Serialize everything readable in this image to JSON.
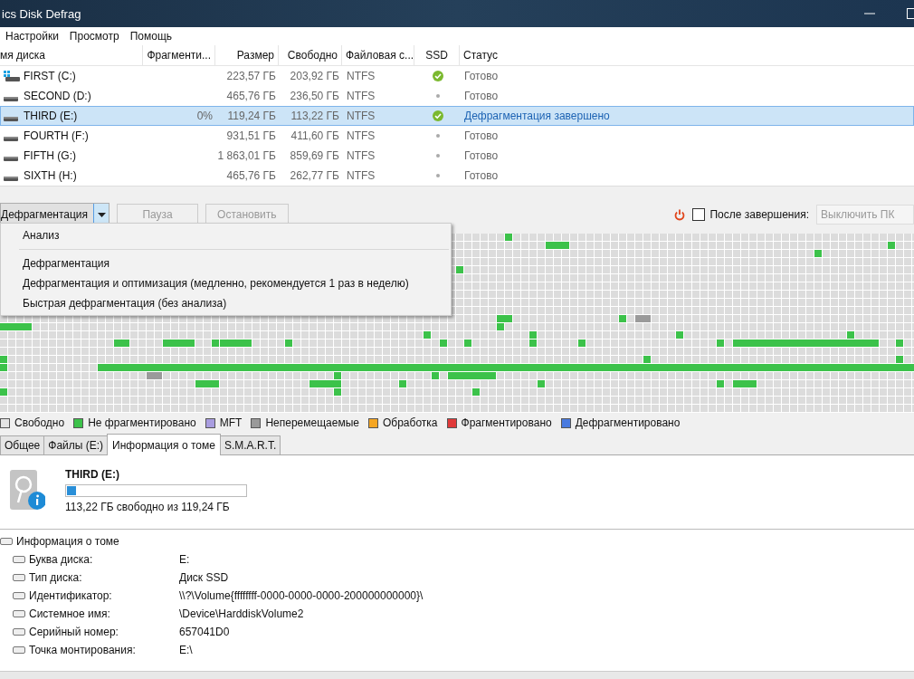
{
  "window": {
    "title": "ics Disk Defrag"
  },
  "menu": [
    "Настройки",
    "Просмотр",
    "Помощь"
  ],
  "disks": {
    "columns": [
      "мя диска",
      "Фрагменти...",
      "Размер",
      "Свободно",
      "Файловая с...",
      "SSD",
      "Статус"
    ],
    "rows": [
      {
        "kind": "system",
        "name": "FIRST (C:)",
        "fragmentation": "",
        "size": "223,57 ГБ",
        "free": "203,92 ГБ",
        "fs": "NTFS",
        "ssd": true,
        "status": "Готово",
        "selected": false
      },
      {
        "kind": "drive",
        "name": "SECOND (D:)",
        "fragmentation": "",
        "size": "465,76 ГБ",
        "free": "236,50 ГБ",
        "fs": "NTFS",
        "ssd": false,
        "status": "Готово",
        "selected": false
      },
      {
        "kind": "drive",
        "name": "THIRD (E:)",
        "fragmentation": "0%",
        "size": "119,24 ГБ",
        "free": "113,22 ГБ",
        "fs": "NTFS",
        "ssd": true,
        "status": "Дефрагментация завершено",
        "selected": true
      },
      {
        "kind": "drive",
        "name": "FOURTH (F:)",
        "fragmentation": "",
        "size": "931,51 ГБ",
        "free": "411,60 ГБ",
        "fs": "NTFS",
        "ssd": false,
        "status": "Готово",
        "selected": false
      },
      {
        "kind": "drive",
        "name": "FIFTH (G:)",
        "fragmentation": "",
        "size": "1 863,01 ГБ",
        "free": "859,69 ГБ",
        "fs": "NTFS",
        "ssd": false,
        "status": "Готово",
        "selected": false
      },
      {
        "kind": "drive",
        "name": "SIXTH (H:)",
        "fragmentation": "",
        "size": "465,76 ГБ",
        "free": "262,77 ГБ",
        "fs": "NTFS",
        "ssd": false,
        "status": "Готово",
        "selected": false
      }
    ]
  },
  "toolbar": {
    "action": "Дефрагментация",
    "pause": {
      "label": "Пауза",
      "disabled": true
    },
    "stop": {
      "label": "Остановить",
      "disabled": true
    },
    "after": {
      "checked": false,
      "disabled": true,
      "label": "После завершения:",
      "value": "Выключить ПК"
    }
  },
  "dropdown": [
    {
      "kind": "item",
      "label": "Анализ"
    },
    {
      "kind": "separator"
    },
    {
      "kind": "item",
      "label": "Дефрагментация"
    },
    {
      "kind": "item",
      "label": "Дефрагментация и оптимизация (медленно, рекомендуется 1 раз в неделю)"
    },
    {
      "kind": "item",
      "label": "Быстрая дефрагментация (без анализа)"
    }
  ],
  "legend": [
    {
      "label": "Свободно",
      "color": "#e4e4e4"
    },
    {
      "label": "Не фрагментировано",
      "color": "#3cc24a"
    },
    {
      "label": "MFT",
      "color": "#a99de0"
    },
    {
      "label": "Неперемещаемые",
      "color": "#9a9a9a"
    },
    {
      "label": "Обработка",
      "color": "#f5a623"
    },
    {
      "label": "Фрагментировано",
      "color": "#e03a3a"
    },
    {
      "label": "Дефрагментировано",
      "color": "#4a7be0"
    }
  ],
  "tabs": [
    {
      "label": "Общее",
      "selected": false
    },
    {
      "label": "Файлы (E:)",
      "selected": false
    },
    {
      "label": "Информация о томе",
      "selected": true
    },
    {
      "label": "S.M.A.R.T.",
      "selected": false
    }
  ],
  "volume": {
    "name": "THIRD (E:)",
    "level": 0.05,
    "free_text": "113,22 ГБ свободно из 119,24 ГБ"
  },
  "info": {
    "title": "Информация о томе",
    "children": [
      {
        "label": "Буква диска:",
        "value": "E:"
      },
      {
        "label": "Тип диска:",
        "value": "Диск SSD"
      },
      {
        "label": "Идентификатор:",
        "value": "\\\\?\\Volume{ffffffff-0000-0000-0000-200000000000}\\"
      },
      {
        "label": "Системное имя:",
        "value": "\\Device\\HarddiskVolume2"
      },
      {
        "label": "Серийный номер:",
        "value": "657041D0"
      },
      {
        "label": "Точка монтирования:",
        "value": "E:\\"
      }
    ]
  }
}
